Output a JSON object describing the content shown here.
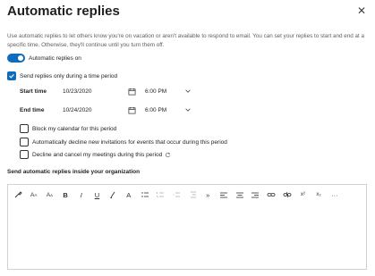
{
  "dialog": {
    "title": "Automatic replies",
    "close_glyph": "✕",
    "description": "Use automatic replies to let others know you're on vacation or aren't available to respond to email. You can set your replies to start and end at a specific time. Otherwise, they'll continue until you turn them off."
  },
  "toggle": {
    "label": "Automatic replies on",
    "on": true
  },
  "time_period": {
    "label": "Send replies only during a time period",
    "checked": true
  },
  "start": {
    "label": "Start time",
    "date": "10/23/2020",
    "time": "6:00 PM"
  },
  "end": {
    "label": "End time",
    "date": "10/24/2020",
    "time": "6:00 PM"
  },
  "options": {
    "block_calendar": {
      "label": "Block my calendar for this period",
      "checked": false
    },
    "decline_invitations": {
      "label": "Automatically decline new invitations for events that occur during this period",
      "checked": false
    },
    "decline_cancel": {
      "label": "Decline and cancel my meetings during this period",
      "checked": false
    }
  },
  "inside_org_heading": "Send automatic replies inside your organization",
  "toolbar": {
    "bold": "B",
    "italic": "I",
    "underline": "U",
    "font_size": "A",
    "grow_font": "A",
    "superscript": "x²",
    "subscript": "x₂",
    "more": "···",
    "quote": "»"
  },
  "colors": {
    "accent": "#0f6cbd",
    "border": "#d1d1d1"
  }
}
